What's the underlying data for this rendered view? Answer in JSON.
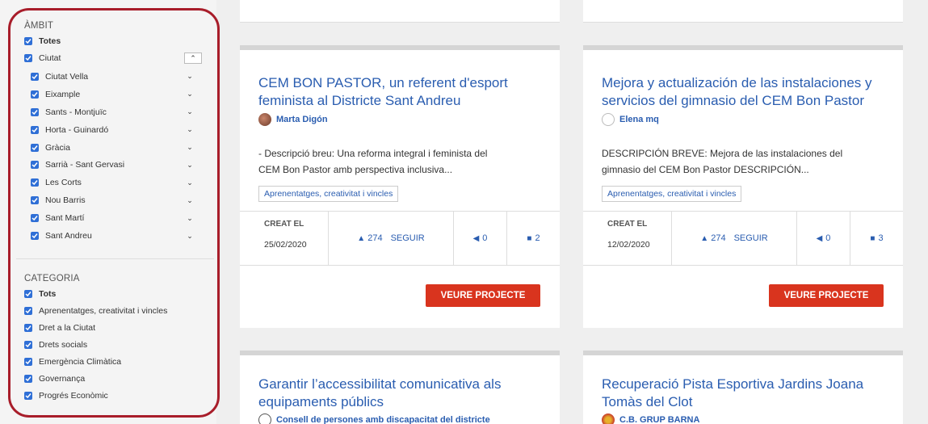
{
  "sidebar": {
    "ambit_title": "ÀMBIT",
    "ambit_items": [
      {
        "label": "Totes",
        "bold": true
      },
      {
        "label": "Ciutat"
      },
      {
        "label": "Ciutat Vella"
      },
      {
        "label": "Eixample"
      },
      {
        "label": "Sants - Montjuïc"
      },
      {
        "label": "Horta - Guinardó"
      },
      {
        "label": "Gràcia"
      },
      {
        "label": "Sarrià - Sant Gervasi"
      },
      {
        "label": "Les Corts"
      },
      {
        "label": "Nou Barris"
      },
      {
        "label": "Sant Martí"
      },
      {
        "label": "Sant Andreu"
      }
    ],
    "categoria_title": "CATEGORIA",
    "categoria_items": [
      {
        "label": "Tots",
        "bold": true
      },
      {
        "label": "Aprenentatges, creativitat i vincles"
      },
      {
        "label": "Dret a la Ciutat"
      },
      {
        "label": "Drets socials"
      },
      {
        "label": "Emergència Climàtica"
      },
      {
        "label": "Governança"
      },
      {
        "label": "Progrés Econòmic"
      }
    ]
  },
  "cards": [
    {
      "title_line1": "CEM BON PASTOR, un referent d'esport",
      "title_line2": "feminista al Districte Sant Andreu",
      "author": "Marta Digón",
      "desc_line1": "- Descripció breu: Una reforma integral i feminista del",
      "desc_line2": "CEM Bon Pastor amb perspectiva inclusiva...",
      "tag": "Aprenentatges, creativitat i vincles",
      "created_label": "CREAT EL",
      "created_date": "25/02/2020",
      "followers": "274",
      "follow_label": "SEGUIR",
      "votes": "0",
      "comments": "2",
      "button": "VEURE PROJECTE"
    },
    {
      "title_line1": "Mejora y actualización de las instalaciones y",
      "title_line2": "servicios del gimnasio del CEM Bon Pastor",
      "author": "Elena mq",
      "desc_line1": "DESCRIPCIÓN BREVE: Mejora de las instalaciones del",
      "desc_line2": "gimnasio del CEM Bon Pastor DESCRIPCIÓN...",
      "tag": "Aprenentatges, creativitat i vincles",
      "created_label": "CREAT EL",
      "created_date": "12/02/2020",
      "followers": "274",
      "follow_label": "SEGUIR",
      "votes": "0",
      "comments": "3",
      "button": "VEURE PROJECTE"
    },
    {
      "title_line1": "Garantir l’accessibilitat comunicativa als",
      "title_line2": "equipaments públics",
      "author": "Consell de persones amb discapacitat del districte"
    },
    {
      "title_line1": "Recuperació Pista Esportiva Jardins Joana",
      "title_line2": "Tomàs del Clot",
      "author": "C.B. GRUP BARNA"
    }
  ],
  "colors": {
    "accent": "#d9341e",
    "link": "#2a5db0",
    "checkbox": "#2f6fd6",
    "highlight": "#a81d2a"
  }
}
